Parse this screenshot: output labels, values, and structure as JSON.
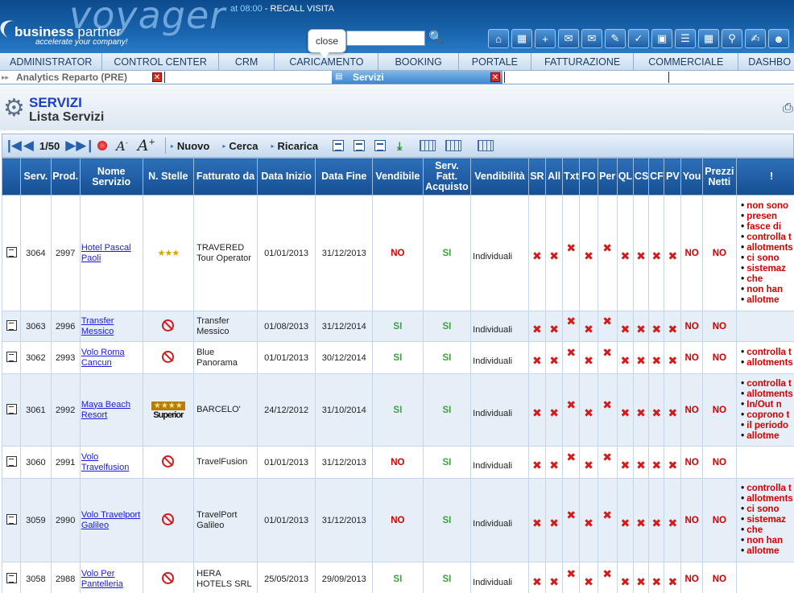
{
  "header": {
    "logo_text": "voyager",
    "brand_bold": "business",
    "brand_rest": " partner",
    "tagline": "accelerate your company!",
    "recall_time": "at 08:00",
    "recall_text": " - RECALL VISITA",
    "tooltip": "close",
    "search_value": "",
    "icons": [
      "home-icon",
      "calendar-icon",
      "calendar-add-icon",
      "mail-in-icon",
      "mail-out-icon",
      "pen-icon",
      "checklist-icon",
      "briefcase-icon",
      "list-icon",
      "calculator-icon",
      "magnifier-icon",
      "notepad-icon",
      "users-icon"
    ]
  },
  "menu": [
    "ADMINISTRATOR",
    "CONTROL CENTER",
    "CRM",
    "CARICAMENTO",
    "BOOKING",
    "PORTALE",
    "FATTURAZIONE",
    "COMMERCIALE",
    "DASHBO"
  ],
  "tabs": {
    "tab1": "Analytics Reparto (PRE)",
    "tab2": "Servizi"
  },
  "page": {
    "title": "SERVIZI",
    "subtitle": "Lista Servizi"
  },
  "toolbar": {
    "page_indicator": "1/50",
    "nuovo": "Nuovo",
    "cerca": "Cerca",
    "ricarica": "Ricarica"
  },
  "columns": [
    "Serv.",
    "Prod.",
    "Nome Servizio",
    "N. Stelle",
    "Fatturato da",
    "Data Inizio",
    "Data Fine",
    "Vendibile",
    "Serv. Fatt. Acquisto",
    "Vendibilità",
    "SR",
    "All",
    "Txt",
    "FO",
    "Per",
    "QL",
    "CS",
    "CF",
    "PV",
    "You",
    "Prezzi Netti",
    "!"
  ],
  "rows": [
    {
      "serv": "3064",
      "prod": "2997",
      "nome": "Hotel Pascal Paoli",
      "stelle": "★★★",
      "fatturato": "TRAVERED Tour Operator",
      "inizio": "01/01/2013",
      "fine": "31/12/2013",
      "vendibile": "NO",
      "fatt_acq": "SI",
      "vendibilita": "Individuali",
      "you": "NO",
      "prezzi": "NO",
      "warn": [
        "non sono",
        "presen",
        "fasce di",
        "controlla t",
        "allotments",
        "ci sono",
        "sistemaz",
        "che",
        "non han",
        "allotme"
      ]
    },
    {
      "serv": "3063",
      "prod": "2996",
      "nome": "Transfer Messico",
      "stelle": "",
      "fatturato": "Transfer Messico",
      "inizio": "01/08/2013",
      "fine": "31/12/2014",
      "vendibile": "SI",
      "fatt_acq": "SI",
      "vendibilita": "Individuali",
      "you": "NO",
      "prezzi": "NO",
      "warn": []
    },
    {
      "serv": "3062",
      "prod": "2993",
      "nome": "Volo Roma Cancun",
      "stelle": "",
      "fatturato": "Blue Panorama",
      "inizio": "01/01/2013",
      "fine": "30/12/2014",
      "vendibile": "SI",
      "fatt_acq": "SI",
      "vendibilita": "Individuali",
      "you": "NO",
      "prezzi": "NO",
      "warn": [
        "controlla t",
        "allotments"
      ]
    },
    {
      "serv": "3061",
      "prod": "2992",
      "nome": "Maya Beach Resort",
      "stelle": "★★★★",
      "stelle_label": "Superior",
      "fatturato": "BARCELO'",
      "inizio": "24/12/2012",
      "fine": "31/10/2014",
      "vendibile": "SI",
      "fatt_acq": "SI",
      "vendibilita": "Individuali",
      "you": "NO",
      "prezzi": "NO",
      "warn": [
        "controlla t",
        "allotments",
        "In/Out n",
        "coprono t",
        "il periodo",
        "allotme"
      ]
    },
    {
      "serv": "3060",
      "prod": "2991",
      "nome": "Volo Travelfusion",
      "stelle": "",
      "fatturato": "TravelFusion",
      "inizio": "01/01/2013",
      "fine": "31/12/2013",
      "vendibile": "NO",
      "fatt_acq": "SI",
      "vendibilita": "Individuali",
      "you": "NO",
      "prezzi": "NO",
      "warn": []
    },
    {
      "serv": "3059",
      "prod": "2990",
      "nome": "Volo Travelport Galileo",
      "stelle": "",
      "fatturato": "TravelPort Galileo",
      "inizio": "01/01/2013",
      "fine": "31/12/2013",
      "vendibile": "NO",
      "fatt_acq": "SI",
      "vendibilita": "Individuali",
      "you": "NO",
      "prezzi": "NO",
      "warn": [
        "controlla t",
        "allotments",
        "ci sono",
        "sistemaz",
        "che",
        "non han",
        "allotme"
      ]
    },
    {
      "serv": "3058",
      "prod": "2988",
      "nome": "Volo Per Pantelleria",
      "stelle": "",
      "fatturato": "HERA HOTELS SRL",
      "inizio": "25/05/2013",
      "fine": "29/09/2013",
      "vendibile": "SI",
      "fatt_acq": "SI",
      "vendibilita": "Individuali",
      "you": "NO",
      "prezzi": "NO",
      "warn": []
    }
  ],
  "colors": {
    "accent": "#1a3fc4",
    "header_bg": "#164f92",
    "ok": "#3aa23a",
    "ko": "#d40000"
  }
}
